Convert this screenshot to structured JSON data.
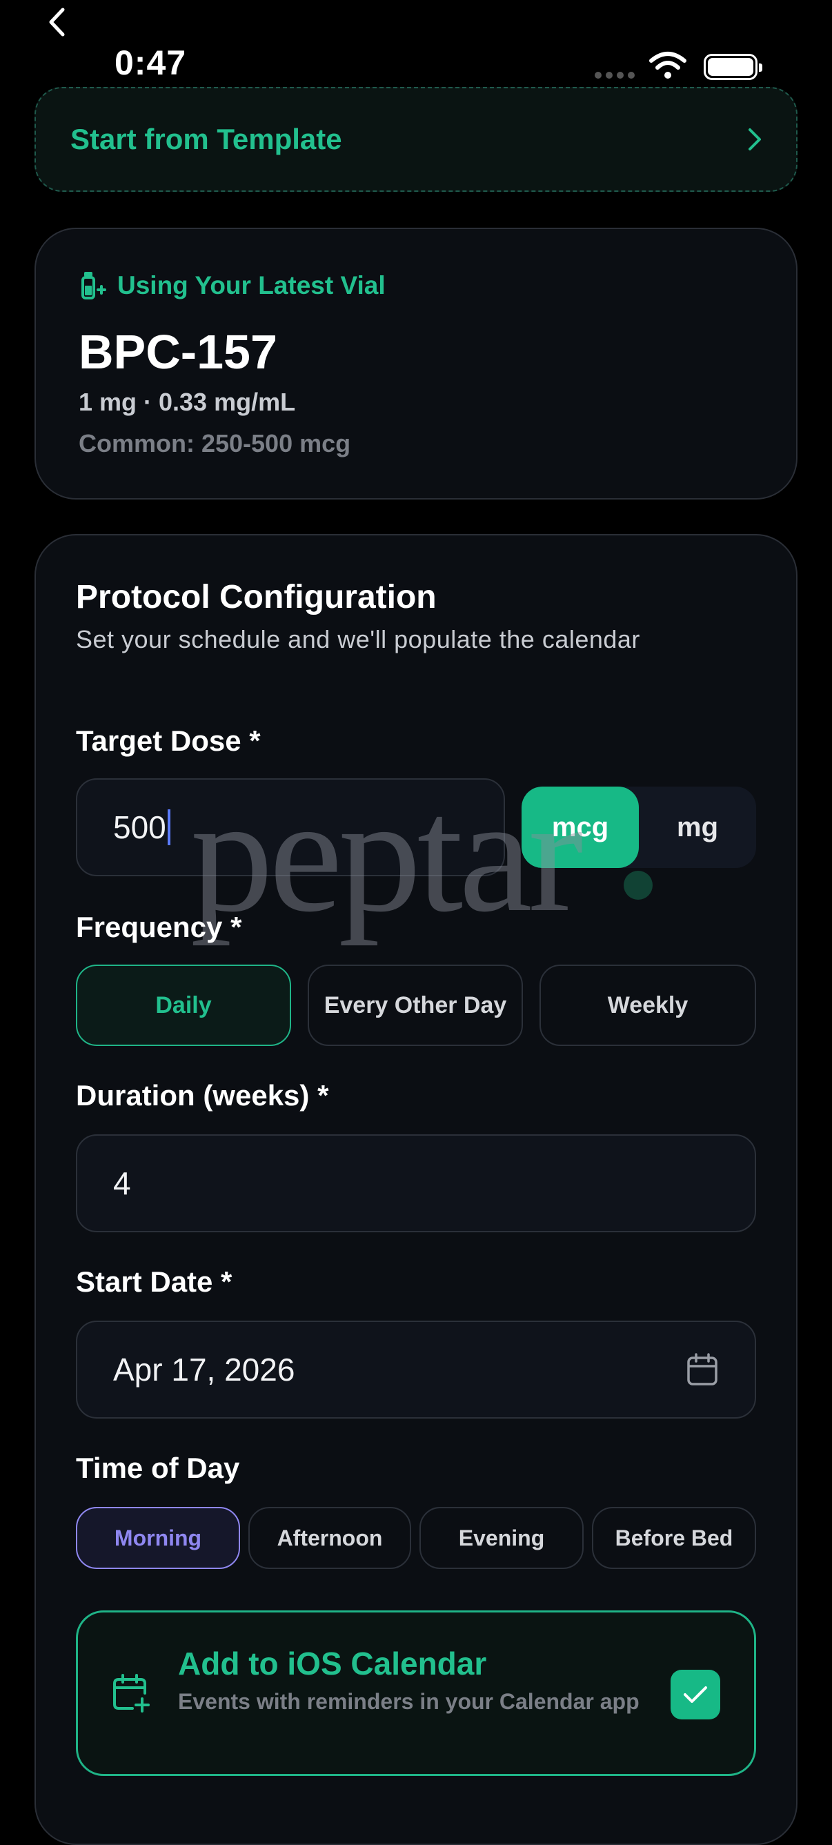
{
  "status_bar": {
    "time": "0:47"
  },
  "template": {
    "label": "Start from Template"
  },
  "vial": {
    "header": "Using Your Latest Vial",
    "name": "BPC-157",
    "spec": "1 mg · 0.33 mg/mL",
    "common": "Common: 250-500 mcg"
  },
  "protocol": {
    "title": "Protocol Configuration",
    "subtitle": "Set your schedule and we'll populate the calendar",
    "target_dose": {
      "label": "Target Dose *",
      "value": "500",
      "units": [
        "mcg",
        "mg"
      ],
      "selected_unit": "mcg"
    },
    "frequency": {
      "label": "Frequency *",
      "options": [
        "Daily",
        "Every Other Day",
        "Weekly"
      ],
      "selected": "Daily"
    },
    "duration": {
      "label": "Duration (weeks) *",
      "value": "4"
    },
    "start_date": {
      "label": "Start Date *",
      "value": "Apr 17, 2026"
    },
    "time_of_day": {
      "label": "Time of Day",
      "options": [
        "Morning",
        "Afternoon",
        "Evening",
        "Before Bed"
      ],
      "selected": "Morning"
    },
    "calendar": {
      "title": "Add to iOS Calendar",
      "subtitle": "Events with reminders in your Calendar app",
      "checked": true
    }
  },
  "watermark": {
    "text": "peptar"
  },
  "colors": {
    "accent_green": "#22c08e",
    "accent_purple": "#8f87f0",
    "background": "#000000",
    "card": "#0b0e13"
  }
}
